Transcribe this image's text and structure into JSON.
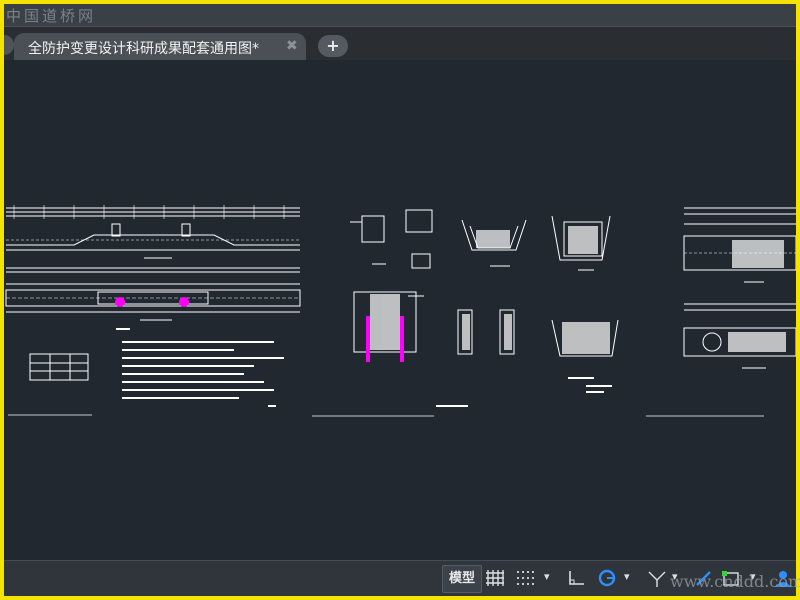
{
  "watermark": {
    "top": "中国道桥网",
    "bottom": "www.cnddd.com"
  },
  "tabs": {
    "document_title": "全防护变更设计科研成果配套通用图*",
    "close_glyph": "✖",
    "new_tab_glyph": "+"
  },
  "statusbar": {
    "model_label": "模型",
    "icons": [
      "grid-icon",
      "snap-grid-icon",
      "ortho-icon",
      "polar-tracking-icon",
      "isometric-icon",
      "dynamic-ucs-icon",
      "selection-icon",
      "workspace-icon"
    ],
    "caret": "▾"
  },
  "colors": {
    "background": "#212830",
    "lines": "#ffffff",
    "highlight": "#ff00ff",
    "border": "#f4e300"
  }
}
